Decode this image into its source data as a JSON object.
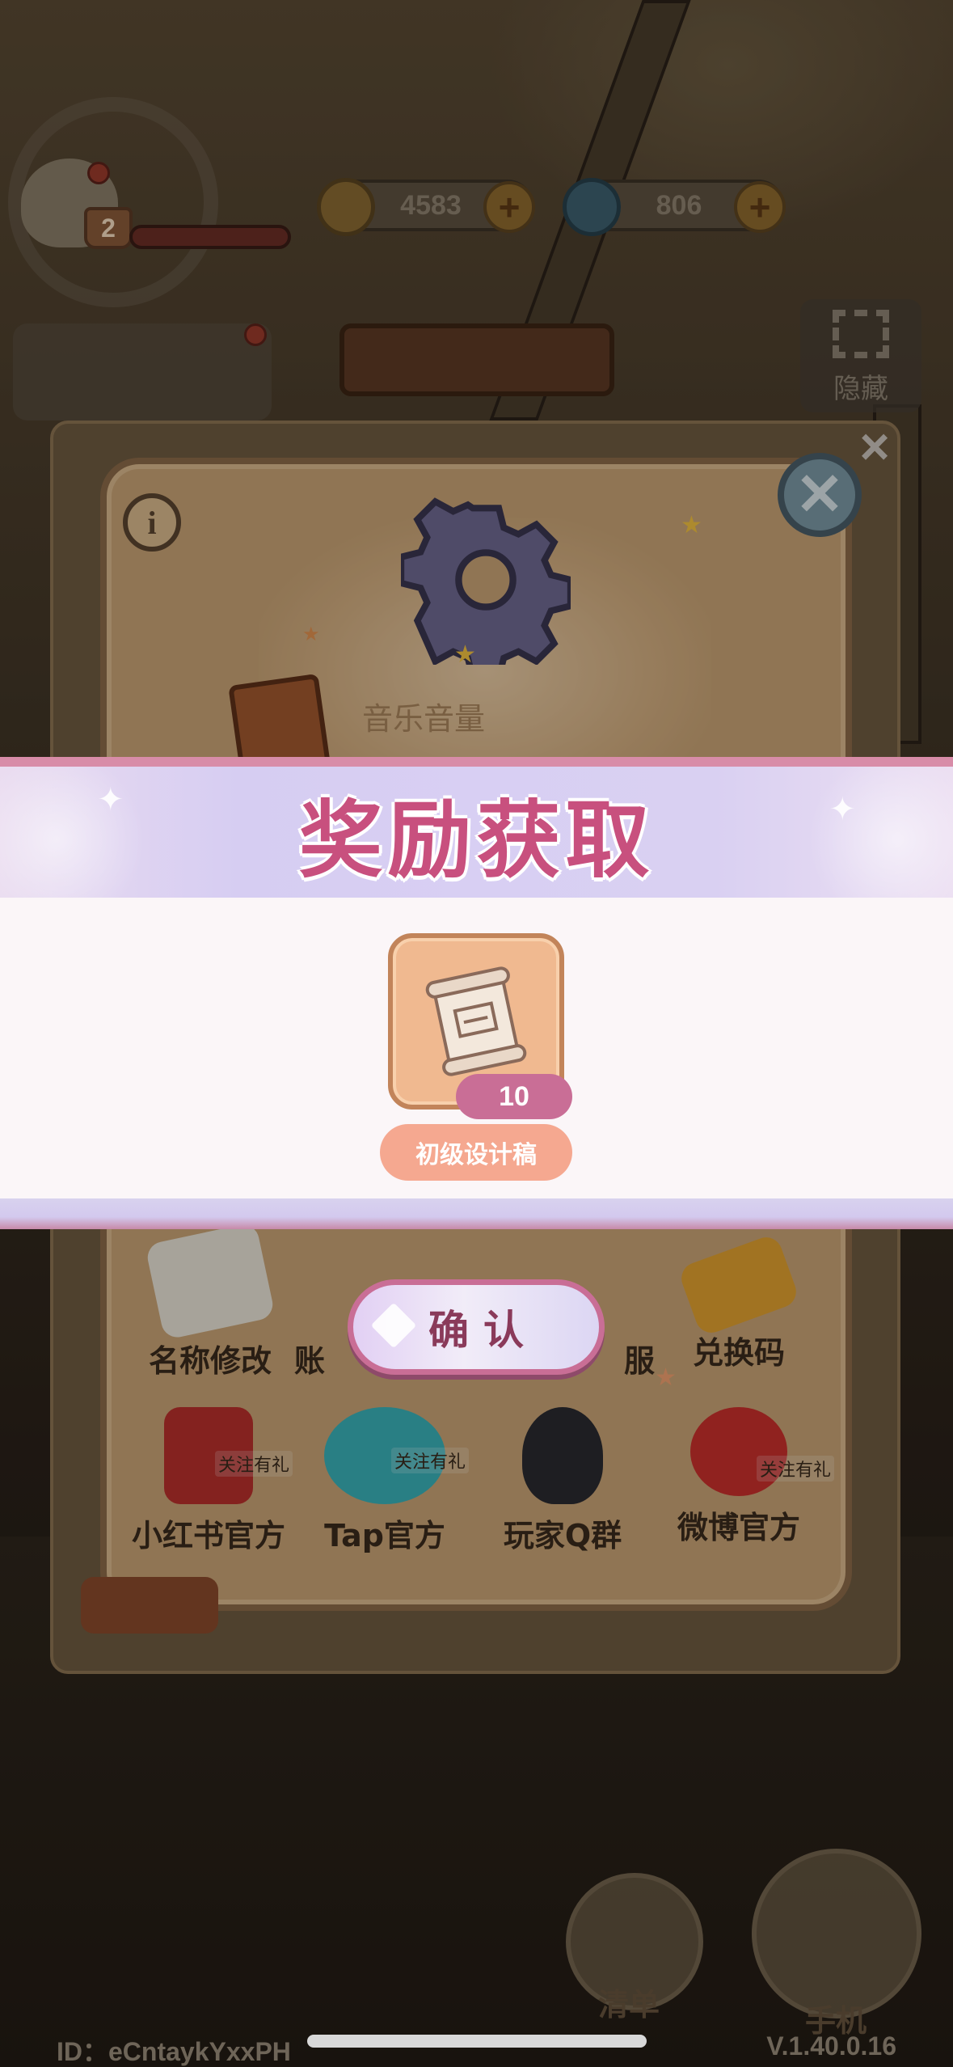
{
  "hud": {
    "level": "2",
    "gold": "4583",
    "gems": "806",
    "hide_label": "隐藏",
    "id_text": "ID：eCntaykYxxPH",
    "version": "V.1.40.0.16",
    "list_label": "清单",
    "phone_label": "手机"
  },
  "settings": {
    "info_label": "i",
    "music_volume_label": "音乐音量",
    "items": [
      {
        "label": "名称修改",
        "icon": "pencil-icon"
      },
      {
        "label": "账",
        "icon": "account-icon"
      },
      {
        "label": "服",
        "icon": "headset-icon"
      },
      {
        "label": "兑换码",
        "icon": "ticket-icon"
      },
      {
        "label": "小红书官方",
        "icon": "xiaohongshu-icon",
        "tag": "关注有礼"
      },
      {
        "label": "Tap官方",
        "icon": "tap-icon",
        "tag": "关注有礼"
      },
      {
        "label": "玩家Q群",
        "icon": "qq-penguin-icon"
      },
      {
        "label": "微博官方",
        "icon": "weibo-icon",
        "tag": "关注有礼"
      }
    ]
  },
  "reward": {
    "title": "奖励获取",
    "item_name": "初级设计稿",
    "item_count": "10",
    "item_icon": "blueprint-scroll-icon",
    "confirm_label": "确认"
  },
  "colors": {
    "title_pink": "#c8507e",
    "band_lavender": "#d8cff3",
    "item_bg": "#f0b990",
    "count_badge": "#c96e96",
    "name_pill": "#f5a890"
  }
}
